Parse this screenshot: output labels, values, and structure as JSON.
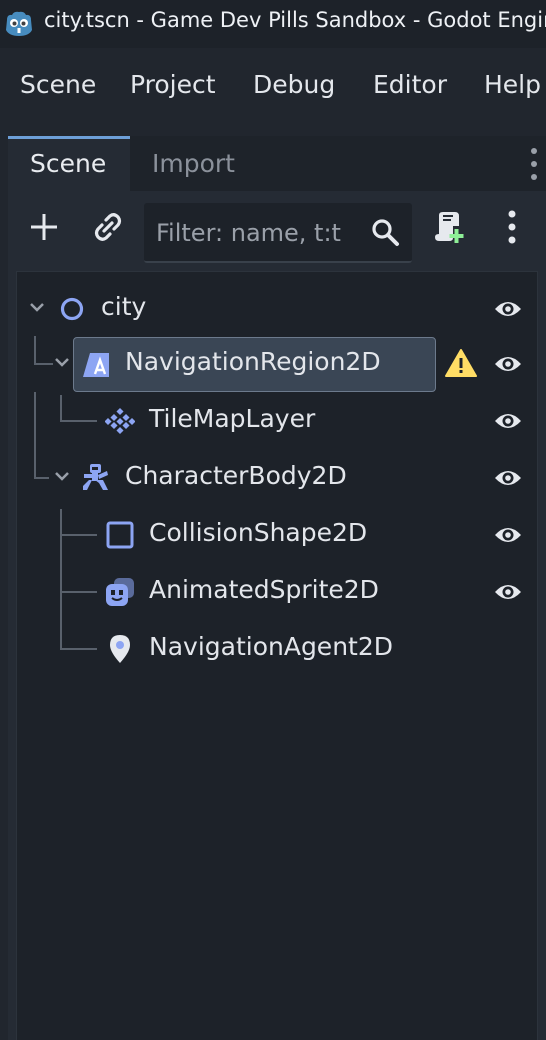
{
  "window": {
    "title": "city.tscn - Game Dev Pills Sandbox - Godot Engine"
  },
  "menu": [
    "Scene",
    "Project",
    "Debug",
    "Editor",
    "Help"
  ],
  "dock": {
    "tabs": [
      {
        "label": "Scene",
        "active": true
      },
      {
        "label": "Import",
        "active": false
      }
    ],
    "toolbar": {
      "add_icon": "plus-icon",
      "link_icon": "link-icon",
      "filter_placeholder": "Filter: name, t:t",
      "filter_value": "",
      "attach_script_icon": "attach-script-icon",
      "menu_icon": "kebab-menu-icon"
    }
  },
  "tree": {
    "nodes": [
      {
        "name": "city",
        "type": "Node2D",
        "icon": "node2d-circle-icon",
        "expanded": true,
        "visible_toggle": true
      },
      {
        "name": "NavigationRegion2D",
        "type": "NavigationRegion2D",
        "icon": "navigation-region-icon",
        "expanded": true,
        "selected": true,
        "warning": true,
        "visible_toggle": true
      },
      {
        "name": "TileMapLayer",
        "type": "TileMapLayer",
        "icon": "tilemap-icon",
        "visible_toggle": true
      },
      {
        "name": "CharacterBody2D",
        "type": "CharacterBody2D",
        "icon": "character-body-icon",
        "expanded": true,
        "visible_toggle": true
      },
      {
        "name": "CollisionShape2D",
        "type": "CollisionShape2D",
        "icon": "collision-shape-icon",
        "visible_toggle": true
      },
      {
        "name": "AnimatedSprite2D",
        "type": "AnimatedSprite2D",
        "icon": "animated-sprite-icon",
        "visible_toggle": true
      },
      {
        "name": "NavigationAgent2D",
        "type": "NavigationAgent2D",
        "icon": "navigation-agent-icon",
        "visible_toggle": false
      }
    ]
  },
  "colors": {
    "node2d_blue": "#8da5f3",
    "warning_yellow": "#ffdd65",
    "add_green": "#8eef97",
    "selection_bg": "#3a4655",
    "accent_tab": "#6d9fd8"
  }
}
